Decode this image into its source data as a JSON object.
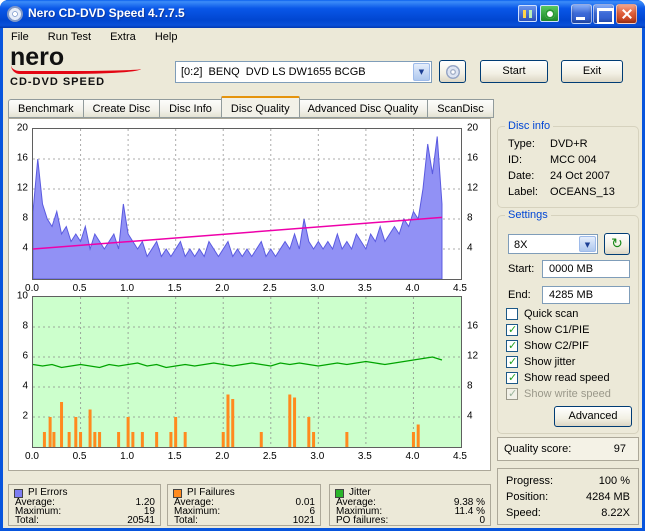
{
  "titlebar": {
    "title": "Nero CD-DVD Speed 4.7.7.5"
  },
  "menu": {
    "items": [
      "File",
      "Run Test",
      "Extra",
      "Help"
    ]
  },
  "header": {
    "brand_line1": "nero",
    "brand_line2": "CD-DVD SPEED",
    "drive": "[0:2]  BENQ  DVD LS DW1655 BCGB",
    "start": "Start",
    "exit": "Exit"
  },
  "icons": {
    "chevron-down": "▼",
    "refresh": "↻"
  },
  "tabs": [
    {
      "label": "Benchmark",
      "active": false
    },
    {
      "label": "Create Disc",
      "active": false
    },
    {
      "label": "Disc Info",
      "active": false
    },
    {
      "label": "Disc Quality",
      "active": true
    },
    {
      "label": "Advanced Disc Quality",
      "active": false
    },
    {
      "label": "ScanDisc",
      "active": false
    }
  ],
  "disc_info": {
    "title": "Disc info",
    "rows": [
      {
        "label": "Type:",
        "value": "DVD+R"
      },
      {
        "label": "ID:",
        "value": "MCC 004"
      },
      {
        "label": "Date:",
        "value": "24 Oct 2007"
      },
      {
        "label": "Label:",
        "value": "OCEANS_13"
      }
    ]
  },
  "settings": {
    "title": "Settings",
    "speed": "8X",
    "start_label": "Start:",
    "start_value": "0000 MB",
    "end_label": "End:",
    "end_value": "4285 MB",
    "checkboxes": [
      {
        "label": "Quick scan",
        "checked": false,
        "disabled": false
      },
      {
        "label": "Show C1/PIE",
        "checked": true,
        "disabled": false
      },
      {
        "label": "Show C2/PIF",
        "checked": true,
        "disabled": false
      },
      {
        "label": "Show jitter",
        "checked": true,
        "disabled": false
      },
      {
        "label": "Show read speed",
        "checked": true,
        "disabled": false
      },
      {
        "label": "Show write speed",
        "checked": true,
        "disabled": true
      }
    ],
    "advanced": "Advanced"
  },
  "quality": {
    "label": "Quality score:",
    "value": "97"
  },
  "status": {
    "rows": [
      {
        "label": "Progress:",
        "value": "100 %"
      },
      {
        "label": "Position:",
        "value": "4284 MB"
      },
      {
        "label": "Speed:",
        "value": "8.22X"
      }
    ]
  },
  "stats": [
    {
      "title": "PI Errors",
      "color": "#7d7df2",
      "rows": [
        {
          "label": "Average:",
          "value": "1.20"
        },
        {
          "label": "Maximum:",
          "value": "19"
        },
        {
          "label": "Total:",
          "value": "20541"
        }
      ]
    },
    {
      "title": "PI Failures",
      "color": "#ff8a1e",
      "rows": [
        {
          "label": "Average:",
          "value": "0.01"
        },
        {
          "label": "Maximum:",
          "value": "6"
        },
        {
          "label": "Total:",
          "value": "1021"
        }
      ]
    },
    {
      "title": "Jitter",
      "color": "#2ab52a",
      "rows": [
        {
          "label": "Average:",
          "value": "9.38 %"
        },
        {
          "label": "Maximum:",
          "value": "11.4 %"
        },
        {
          "label": "PO failures:",
          "value": "0"
        }
      ]
    }
  ],
  "chart_data": [
    {
      "type": "area",
      "name": "pi-errors-with-read-speed",
      "bg": "#ffffff",
      "grid_color": "#ababab",
      "xlim": [
        0,
        4.5
      ],
      "left_ylim": [
        0,
        20
      ],
      "right_ylim": [
        0,
        20
      ],
      "grid_x": [
        0.5,
        1.0,
        1.5,
        2.0,
        2.5,
        3.0,
        3.5,
        4.0
      ],
      "grid_y": [
        4,
        8,
        12,
        16
      ],
      "left_ticks": [
        20,
        16,
        12,
        8,
        4
      ],
      "right_ticks": [
        20,
        16,
        12,
        8,
        4
      ],
      "x_ticks": [
        {
          "v": 0,
          "label": "0.0"
        },
        {
          "v": 0.5,
          "label": "0.5"
        },
        {
          "v": 1,
          "label": "1.0"
        },
        {
          "v": 1.5,
          "label": "1.5"
        },
        {
          "v": 2,
          "label": "2.0"
        },
        {
          "v": 2.5,
          "label": "2.5"
        },
        {
          "v": 3,
          "label": "3.0"
        },
        {
          "v": 3.5,
          "label": "3.5"
        },
        {
          "v": 4,
          "label": "4.0"
        },
        {
          "v": 4.5,
          "label": "4.5"
        }
      ],
      "series": [
        {
          "name": "pi-errors",
          "type": "area",
          "axis": "left",
          "x0": 0,
          "x_step": 0.05,
          "fill": "#9191f5",
          "color": "#5a5ae0",
          "values": [
            9,
            16,
            10,
            8,
            7,
            9,
            6,
            7,
            5,
            6,
            5,
            7,
            4,
            6,
            5,
            4,
            5,
            6,
            4,
            10,
            6,
            5,
            4,
            5,
            3,
            4,
            5,
            3,
            4,
            3,
            4,
            5,
            3,
            4,
            3,
            4,
            3,
            5,
            4,
            3,
            4,
            5,
            3,
            4,
            3,
            4,
            3,
            4,
            5,
            3,
            4,
            3,
            4,
            5,
            4,
            6,
            4,
            8,
            5,
            4,
            5,
            4,
            5,
            4,
            6,
            4,
            5,
            4,
            6,
            5,
            4,
            6,
            5,
            7,
            5,
            6,
            7,
            6,
            8,
            7,
            9,
            8,
            12,
            18,
            14,
            19,
            10
          ]
        },
        {
          "name": "read-speed",
          "type": "line",
          "axis": "right",
          "color": "#ee00aa",
          "width": 1.5,
          "points": [
            [
              0,
              4.0
            ],
            [
              4.3,
              8.22
            ]
          ]
        }
      ]
    },
    {
      "type": "mixed",
      "name": "jitter-with-pi-failures",
      "bg": "#ccffcc",
      "grid_color": "#9aa89a",
      "xlim": [
        0,
        4.5
      ],
      "left_ylim": [
        0,
        10
      ],
      "right_ylim": [
        0,
        20
      ],
      "grid_x": [
        0.5,
        1.0,
        1.5,
        2.0,
        2.5,
        3.0,
        3.5,
        4.0
      ],
      "grid_y": [
        2,
        4,
        6,
        8
      ],
      "left_ticks": [
        10,
        8,
        6,
        4,
        2
      ],
      "right_ticks": [
        16,
        12,
        8,
        4
      ],
      "x_ticks": [
        {
          "v": 0,
          "label": "0.0"
        },
        {
          "v": 0.5,
          "label": "0.5"
        },
        {
          "v": 1,
          "label": "1.0"
        },
        {
          "v": 1.5,
          "label": "1.5"
        },
        {
          "v": 2,
          "label": "2.0"
        },
        {
          "v": 2.5,
          "label": "2.5"
        },
        {
          "v": 3,
          "label": "3.0"
        },
        {
          "v": 3.5,
          "label": "3.5"
        },
        {
          "v": 4,
          "label": "4.0"
        },
        {
          "v": 4.5,
          "label": "4.5"
        }
      ],
      "series": [
        {
          "name": "pi-failures",
          "type": "bars",
          "axis": "left",
          "color": "#ff8a1e",
          "points": [
            [
              0.12,
              1
            ],
            [
              0.18,
              2
            ],
            [
              0.22,
              1
            ],
            [
              0.3,
              3
            ],
            [
              0.38,
              1
            ],
            [
              0.45,
              2
            ],
            [
              0.5,
              1
            ],
            [
              0.6,
              2.5
            ],
            [
              0.65,
              1
            ],
            [
              0.7,
              1
            ],
            [
              0.9,
              1
            ],
            [
              1.0,
              2
            ],
            [
              1.05,
              1
            ],
            [
              1.15,
              1
            ],
            [
              1.3,
              1
            ],
            [
              1.45,
              1
            ],
            [
              1.5,
              2
            ],
            [
              1.6,
              1
            ],
            [
              2.0,
              1
            ],
            [
              2.05,
              3.5
            ],
            [
              2.1,
              3.2
            ],
            [
              2.4,
              1
            ],
            [
              2.7,
              3.5
            ],
            [
              2.75,
              3.3
            ],
            [
              2.9,
              2
            ],
            [
              2.95,
              1
            ],
            [
              3.3,
              1
            ],
            [
              4.0,
              1
            ],
            [
              4.05,
              1.5
            ]
          ]
        },
        {
          "name": "jitter",
          "type": "line",
          "axis": "left",
          "color": "#00a400",
          "width": 1.3,
          "x0": 0,
          "x_step": 0.1,
          "values": [
            5.5,
            5.4,
            5.5,
            5.3,
            5.4,
            5.5,
            5.4,
            5.3,
            5.5,
            5.4,
            5.5,
            5.6,
            5.4,
            5.5,
            5.3,
            5.4,
            5.5,
            5.4,
            5.5,
            5.6,
            5.5,
            5.4,
            5.5,
            5.6,
            5.5,
            5.4,
            5.6,
            5.5,
            5.6,
            5.5,
            5.4,
            5.5,
            5.6,
            5.5,
            5.6,
            5.7,
            5.6,
            5.5,
            5.6,
            5.7,
            5.8,
            5.9,
            6.0,
            5.8
          ]
        }
      ]
    }
  ]
}
